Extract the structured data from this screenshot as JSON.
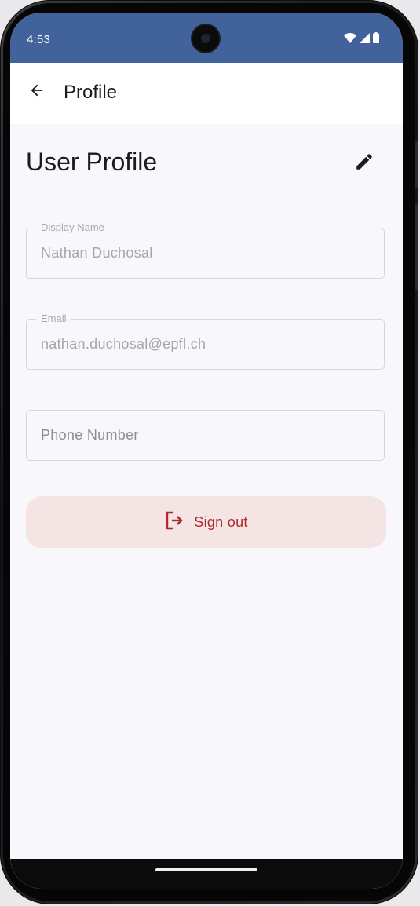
{
  "status_bar": {
    "time": "4:53",
    "icons": [
      "wifi-icon",
      "signal-icon",
      "battery-icon"
    ],
    "background": "#42629b"
  },
  "app_bar": {
    "back_icon": "arrow-back-icon",
    "title": "Profile"
  },
  "profile": {
    "title": "User Profile",
    "edit_icon": "pencil-icon",
    "fields": [
      {
        "label": "Display Name",
        "value": "Nathan Duchosal",
        "placeholder": ""
      },
      {
        "label": "Email",
        "value": "nathan.duchosal@epfl.ch",
        "placeholder": ""
      },
      {
        "label": "",
        "value": "",
        "placeholder": "Phone Number"
      }
    ],
    "sign_out": {
      "label": "Sign out",
      "icon": "logout-icon",
      "color": "#b3262a",
      "background": "#f4e4e4"
    }
  }
}
